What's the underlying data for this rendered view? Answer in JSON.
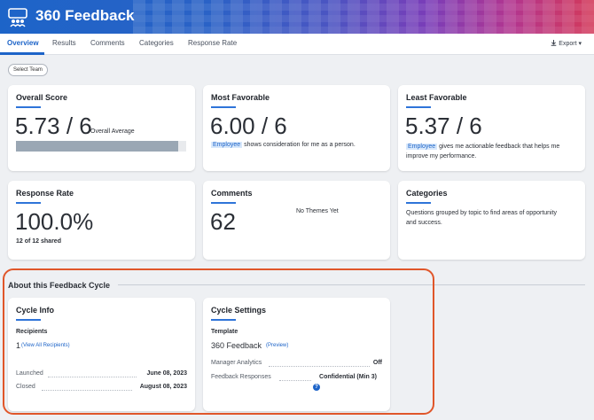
{
  "app": {
    "title": "360 Feedback"
  },
  "tabs": [
    {
      "label": "Overview",
      "active": true
    },
    {
      "label": "Results"
    },
    {
      "label": "Comments"
    },
    {
      "label": "Categories"
    },
    {
      "label": "Response Rate"
    }
  ],
  "toolbar": {
    "export_label": "Export ▾"
  },
  "filters": {
    "select_team_label": "Select Team"
  },
  "overall_score": {
    "title": "Overall Score",
    "value": "5.73 / 6",
    "caption": "Overall Average",
    "fraction": 0.955
  },
  "most_favorable": {
    "title": "Most Favorable",
    "value": "6.00 / 6",
    "tag": "Employee",
    "text": "shows consideration for me as a person."
  },
  "least_favorable": {
    "title": "Least Favorable",
    "value": "5.37 / 6",
    "tag": "Employee",
    "text_line1": "gives me actionable feedback that helps me",
    "text_line2": "improve my performance."
  },
  "response_rate": {
    "title": "Response Rate",
    "value": "100.0%",
    "shared": "12 of 12 shared"
  },
  "comments": {
    "title": "Comments",
    "value": "62",
    "themes": "No Themes Yet"
  },
  "categories": {
    "title": "Categories",
    "text_line1": "Questions grouped by topic to find areas of opportunity",
    "text_line2": "and success."
  },
  "about": {
    "section_title": "About this Feedback Cycle"
  },
  "cycle_info": {
    "title": "Cycle Info",
    "recipients_label": "Recipients",
    "recipients_count": "1",
    "view_all": "(View All Recipients)",
    "launched_label": "Launched",
    "launched_value": "June 08, 2023",
    "closed_label": "Closed",
    "closed_value": "August 08, 2023"
  },
  "cycle_settings": {
    "title": "Cycle Settings",
    "template_label": "Template",
    "template_value": "360 Feedback",
    "preview": "(Preview)",
    "manager_analytics_label": "Manager Analytics",
    "manager_analytics_value": "Off",
    "feedback_responses_label": "Feedback Responses",
    "feedback_responses_value": "Confidential (Min 3)"
  },
  "colors": {
    "accent": "#1d64c8",
    "highlight": "#e0562a",
    "bar": "#9aa7b4"
  },
  "icons": {
    "logo": "people-group-icon",
    "export": "download-icon",
    "help": "question-circle-icon"
  }
}
